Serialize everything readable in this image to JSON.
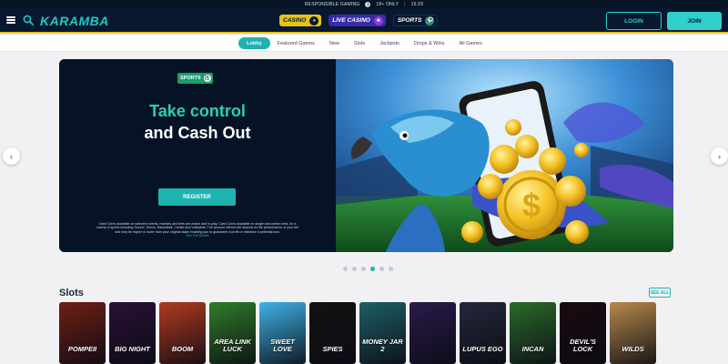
{
  "top_strip": {
    "responsible": "RESPONSIBLE GAMING",
    "age_badge": "18+",
    "age": "18+ ONLY",
    "time": "19:29"
  },
  "header": {
    "logo": "KARAMBA",
    "tabs": [
      {
        "label": "CASINO",
        "icon": "casino-chip-icon"
      },
      {
        "label": "LIVE CASINO",
        "icon": "live-dealer-icon"
      },
      {
        "label": "SPORTS",
        "icon": "soccer-ball-icon"
      }
    ],
    "login": "LOGIN",
    "join": "JOIN"
  },
  "nav": {
    "items": [
      "Lobby",
      "Featured Games",
      "New",
      "Slots",
      "Jackpots",
      "Drops & Wins",
      "All Games"
    ],
    "active": "Lobby"
  },
  "banner": {
    "chip": "SPORTS",
    "headline_1": "Take control",
    "headline_2": "and Cash Out",
    "cta": "REGISTER",
    "terms": "Cash Out is available on selected events, markets and bets pre-match and in-play. Cash Out is available on single and combo bets, for a variety of sports including Soccer, Tennis, Basketball, Cricket and Volleyball. The amount offered will depend on the performance of your bet and may be higher or lower than your original stake enabling you to guarantee a profit or minimise a potential loss.",
    "terms_link": "See Full Details",
    "slide_count": 6,
    "active_slide": 4
  },
  "slots": {
    "title": "Slots",
    "see_all": "SEE ALL",
    "games": [
      {
        "title": "POMPEII",
        "color": "#6e1f14"
      },
      {
        "title": "BIG NIGHT",
        "color": "#2a1036"
      },
      {
        "title": "BOOM",
        "color": "#b23b1d"
      },
      {
        "title": "AREA LINK LUCK",
        "color": "#2f7d2a"
      },
      {
        "title": "SWEET LOVE",
        "color": "#3fb3e6"
      },
      {
        "title": "SPIES",
        "color": "#121212"
      },
      {
        "title": "MONEY JAR 2",
        "color": "#1d5f66"
      },
      {
        "title": "",
        "color": "#2a1a4a"
      },
      {
        "title": "LUPUS EGO",
        "color": "#23283a"
      },
      {
        "title": "INCAN",
        "color": "#2b6b2a"
      },
      {
        "title": "DEVIL'S LOCK",
        "color": "#1a0a10"
      },
      {
        "title": "WILDS",
        "color": "#b88a4a"
      }
    ]
  }
}
